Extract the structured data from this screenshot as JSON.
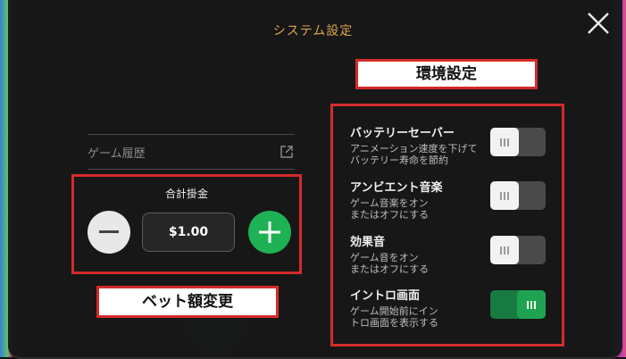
{
  "header": {
    "title": "システム設定"
  },
  "annotations": {
    "environment_settings": "環境設定",
    "bet_change": "ベット額変更"
  },
  "history": {
    "label": "ゲーム履歴"
  },
  "bet": {
    "title": "合計掛金",
    "value": "$1.00"
  },
  "settings": [
    {
      "name": "バッテリーセーバー",
      "desc_line1": "アニメーション速度を下げて",
      "desc_line2": "バッテリー寿命を節約",
      "enabled": false
    },
    {
      "name": "アンビエント音楽",
      "desc_line1": "ゲーム音楽をオン",
      "desc_line2": "またはオフにする",
      "enabled": false
    },
    {
      "name": "効果音",
      "desc_line1": "ゲーム音をオン",
      "desc_line2": "またはオフにする",
      "enabled": false
    },
    {
      "name": "イントロ画面",
      "desc_line1": "ゲーム開始前にイン",
      "desc_line2": "トロ画面を表示する",
      "enabled": true
    }
  ],
  "colors": {
    "title": "#d9a44a",
    "annotation_border": "#d42b2b",
    "plus_button": "#1fb155",
    "toggle_on": "#1fa352"
  },
  "icons": {
    "close": "close-icon",
    "external_link": "external-link-icon",
    "minus": "minus-icon",
    "plus": "plus-icon"
  }
}
